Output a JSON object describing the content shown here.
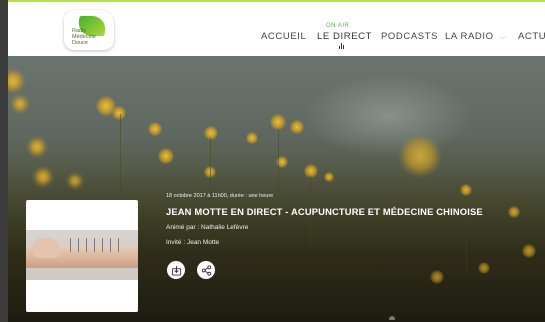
{
  "logo": {
    "lines": [
      "Radio",
      "Médecine",
      "Douce"
    ],
    "leaf_color_start": "#4caf2e",
    "leaf_color_end": "#a7d93a"
  },
  "nav": {
    "items": [
      {
        "label": "ACCUEIL"
      },
      {
        "label": "LE DIRECT",
        "badge": "ON AIR",
        "active": true
      },
      {
        "label": "PODCASTS"
      },
      {
        "label": "LA RADIO",
        "has_dropdown": true
      },
      {
        "label": "ACTUS"
      }
    ],
    "onair_color": "#57b657"
  },
  "episode": {
    "meta": "18 octobre 2017 à 11h00, durée : une heure",
    "title": "JEAN MOTTE EN DIRECT - ACUPUNCTURE ET MÉDECINE CHINOISE",
    "host": "Animé par : Nathalie Lefèvre",
    "guest": "Invité : Jean Motte"
  },
  "actions": {
    "download_icon": "download-icon",
    "share_icon": "share-icon"
  },
  "colors": {
    "accent_green": "#b6e23a",
    "text_dark": "#444444"
  }
}
